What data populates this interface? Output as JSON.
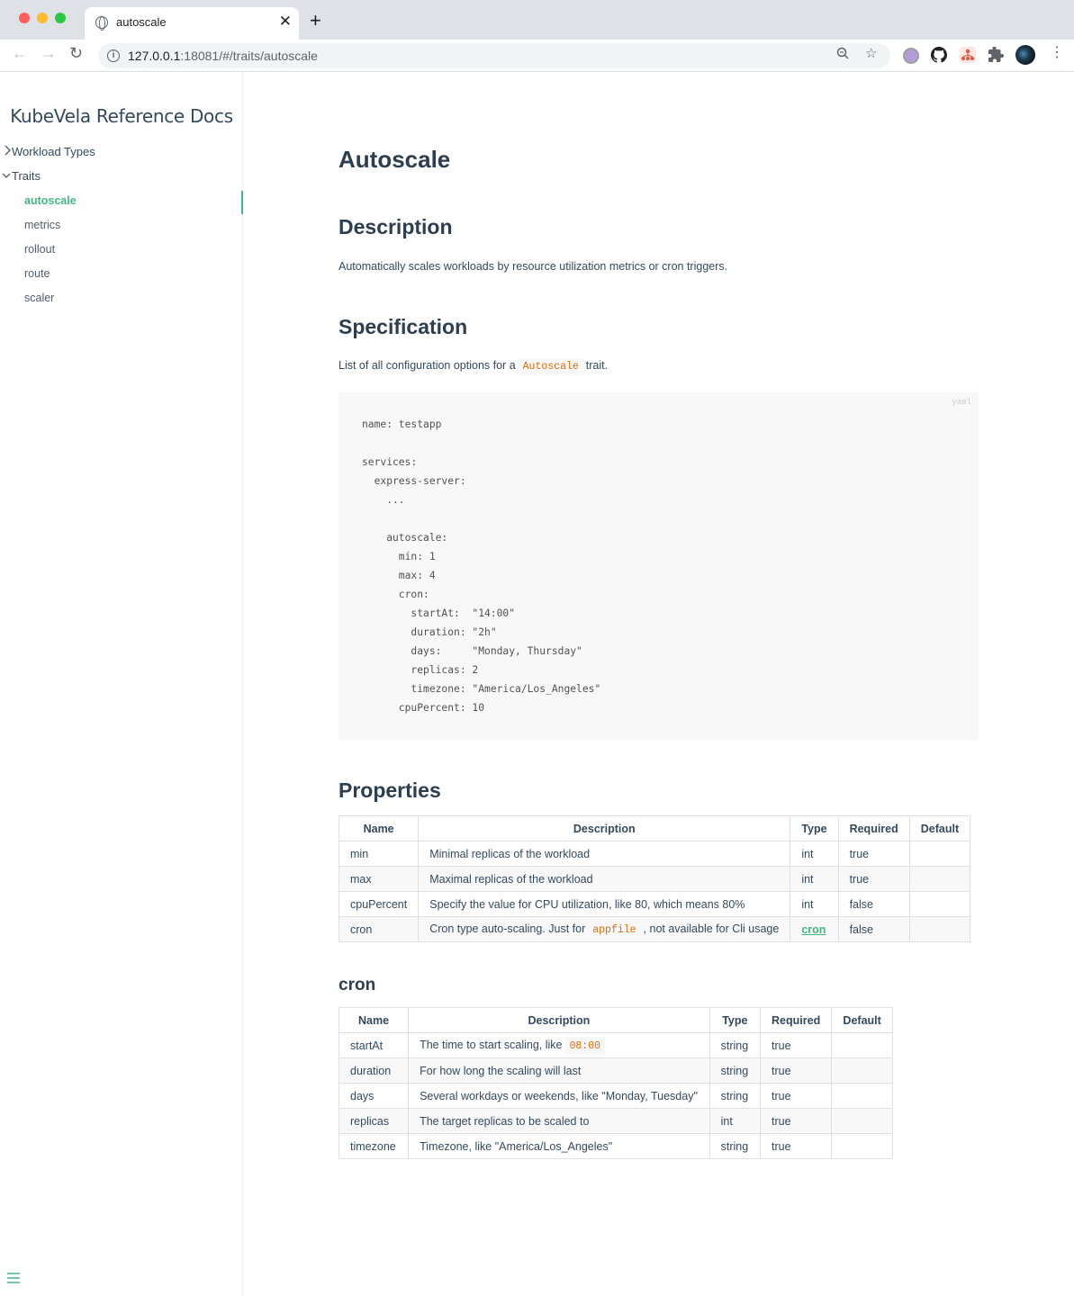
{
  "browser": {
    "tab_title": "autoscale",
    "url_host": "127.0.0.1",
    "url_rest": ":18081/#/traits/autoscale"
  },
  "sidebar": {
    "app_name": "KubeVela Reference Docs",
    "groups": [
      {
        "label": "Workload Types",
        "expanded": false
      },
      {
        "label": "Traits",
        "expanded": true
      }
    ],
    "items": [
      {
        "label": "autoscale",
        "active": true
      },
      {
        "label": "metrics"
      },
      {
        "label": "rollout"
      },
      {
        "label": "route"
      },
      {
        "label": "scaler"
      }
    ]
  },
  "content": {
    "title": "Autoscale",
    "description_heading": "Description",
    "description_text": "Automatically scales workloads by resource utilization metrics or cron triggers.",
    "spec_heading": "Specification",
    "spec_text_before": "List of all configuration options for a",
    "spec_code": "Autoscale",
    "spec_text_after": "trait.",
    "code_lang": "yaml",
    "code": "name: testapp\n\nservices:\n  express-server:\n    ...\n\n    autoscale:\n      min: 1\n      max: 4\n      cron:\n        startAt:  \"14:00\"\n        duration: \"2h\"\n        days:     \"Monday, Thursday\"\n        replicas: 2\n        timezone: \"America/Los_Angeles\"\n      cpuPercent: 10",
    "properties_heading": "Properties",
    "properties_headers": [
      "Name",
      "Description",
      "Type",
      "Required",
      "Default"
    ],
    "properties_rows": [
      {
        "name": "min",
        "desc": "Minimal replicas of the workload",
        "type": "int",
        "required": "true",
        "default": ""
      },
      {
        "name": "max",
        "desc": "Maximal replicas of the workload",
        "type": "int",
        "required": "true",
        "default": ""
      },
      {
        "name": "cpuPercent",
        "desc": "Specify the value for CPU utilization, like 80, which means 80%",
        "type": "int",
        "required": "false",
        "default": ""
      },
      {
        "name": "cron",
        "desc_before": "Cron type auto-scaling. Just for",
        "desc_code": "appfile",
        "desc_after": ", not available for Cli usage",
        "type": "cron",
        "required": "false",
        "default": ""
      }
    ],
    "cron_heading": "cron",
    "cron_headers": [
      "Name",
      "Description",
      "Type",
      "Required",
      "Default"
    ],
    "cron_rows": [
      {
        "name": "startAt",
        "desc_before": "The time to start scaling, like",
        "desc_code": "08:00",
        "type": "string",
        "required": "true",
        "default": ""
      },
      {
        "name": "duration",
        "desc": "For how long the scaling will last",
        "type": "string",
        "required": "true",
        "default": ""
      },
      {
        "name": "days",
        "desc": "Several workdays or weekends, like \"Monday, Tuesday\"",
        "type": "string",
        "required": "true",
        "default": ""
      },
      {
        "name": "replicas",
        "desc": "The target replicas to be scaled to",
        "type": "int",
        "required": "true",
        "default": ""
      },
      {
        "name": "timezone",
        "desc": "Timezone, like \"America/Los_Angeles\"",
        "type": "string",
        "required": "true",
        "default": ""
      }
    ]
  },
  "colors": {
    "accent": "#42b983",
    "heading": "#2c3e50",
    "text": "#34495e",
    "inline_code": "#e96900",
    "code_bg": "#f8f8f8"
  }
}
